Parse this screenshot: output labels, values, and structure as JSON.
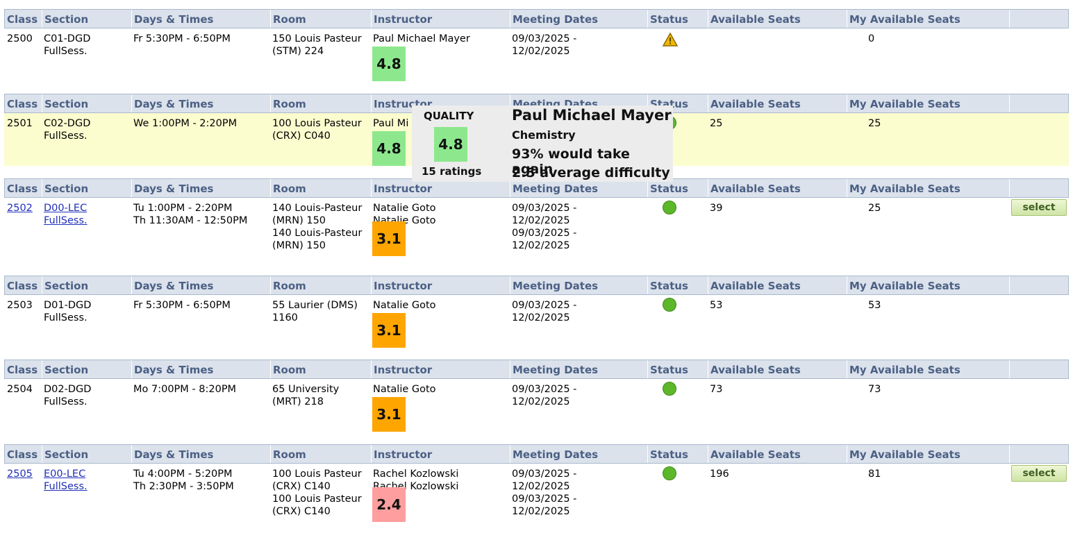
{
  "headers": [
    "Class",
    "Section",
    "Days & Times",
    "Room",
    "Instructor",
    "Meeting Dates",
    "Status",
    "Available Seats",
    "My Available Seats",
    ""
  ],
  "colors": {
    "rating_high": "#8de88d",
    "rating_mid": "#ffa500",
    "rating_low": "#ff9e9e",
    "status_open": "#5cb82a",
    "row_highlight": "#fbfdcf"
  },
  "sections": [
    {
      "class": "2500",
      "class_link": false,
      "section": [
        "C01-DGD",
        "FullSess."
      ],
      "times": [
        "Fr 5:30PM - 6:50PM"
      ],
      "room": [
        "150 Louis Pasteur",
        "(STM) 224"
      ],
      "instructors": [
        "Paul Michael Mayer"
      ],
      "rating": "4.8",
      "rating_color": "#8de88d",
      "dates": [
        "09/03/2025 -",
        "12/02/2025"
      ],
      "status": "warning-icon",
      "available": "",
      "my_available": "0",
      "select": ""
    },
    {
      "class": "2501",
      "class_link": false,
      "section": [
        "C02-DGD",
        "FullSess."
      ],
      "times": [
        "We 1:00PM - 2:20PM"
      ],
      "room": [
        "100 Louis Pasteur",
        "(CRX) C040"
      ],
      "instructors": [
        "Paul Mi"
      ],
      "rating": "4.8",
      "rating_color": "#8de88d",
      "dates": [
        "",
        ""
      ],
      "status": "open-icon",
      "available": "25",
      "my_available": "25",
      "select": ""
    },
    {
      "class": "2502",
      "class_link": true,
      "section": [
        "D00-LEC",
        "FullSess."
      ],
      "times": [
        "Tu 1:00PM - 2:20PM",
        "Th 11:30AM - 12:50PM"
      ],
      "room": [
        "140 Louis-Pasteur",
        "(MRN) 150",
        "140 Louis-Pasteur",
        "(MRN) 150"
      ],
      "instructors": [
        "Natalie Goto",
        "Natalie Goto"
      ],
      "rating": "3.1",
      "rating_color": "#ffa500",
      "dates": [
        "09/03/2025 -",
        "12/02/2025",
        "09/03/2025 -",
        "12/02/2025"
      ],
      "status": "open-icon",
      "available": "39",
      "my_available": "25",
      "select": "select"
    },
    {
      "class": "2503",
      "class_link": false,
      "section": [
        "D01-DGD",
        "FullSess."
      ],
      "times": [
        "Fr 5:30PM - 6:50PM"
      ],
      "room": [
        "55 Laurier (DMS)",
        "1160"
      ],
      "instructors": [
        "Natalie Goto"
      ],
      "rating": "3.1",
      "rating_color": "#ffa500",
      "dates": [
        "09/03/2025 -",
        "12/02/2025"
      ],
      "status": "open-icon",
      "available": "53",
      "my_available": "53",
      "select": ""
    },
    {
      "class": "2504",
      "class_link": false,
      "section": [
        "D02-DGD",
        "FullSess."
      ],
      "times": [
        "Mo 7:00PM - 8:20PM"
      ],
      "room": [
        "65 University",
        "(MRT) 218"
      ],
      "instructors": [
        "Natalie Goto"
      ],
      "rating": "3.1",
      "rating_color": "#ffa500",
      "dates": [
        "09/03/2025 -",
        "12/02/2025"
      ],
      "status": "open-icon",
      "available": "73",
      "my_available": "73",
      "select": ""
    },
    {
      "class": "2505",
      "class_link": true,
      "section": [
        "E00-LEC",
        "FullSess."
      ],
      "times": [
        "Tu 4:00PM - 5:20PM",
        "Th 2:30PM - 3:50PM"
      ],
      "room": [
        "100 Louis Pasteur",
        "(CRX) C140",
        "100 Louis Pasteur",
        "(CRX) C140"
      ],
      "instructors": [
        "Rachel Kozlowski",
        "Rachel Kozlowski"
      ],
      "rating": "2.4",
      "rating_color": "#ff9e9e",
      "dates": [
        "09/03/2025 -",
        "12/02/2025",
        "09/03/2025 -",
        "12/02/2025"
      ],
      "status": "open-icon",
      "available": "196",
      "my_available": "81",
      "select": "select"
    }
  ],
  "popup": {
    "quality_label": "QUALITY",
    "quality_value": "4.8",
    "ratings_count": "15 ratings",
    "name": "Paul Michael Mayer",
    "department": "Chemistry",
    "take_again": "93% would take again",
    "difficulty": "2.5 average difficulty"
  }
}
